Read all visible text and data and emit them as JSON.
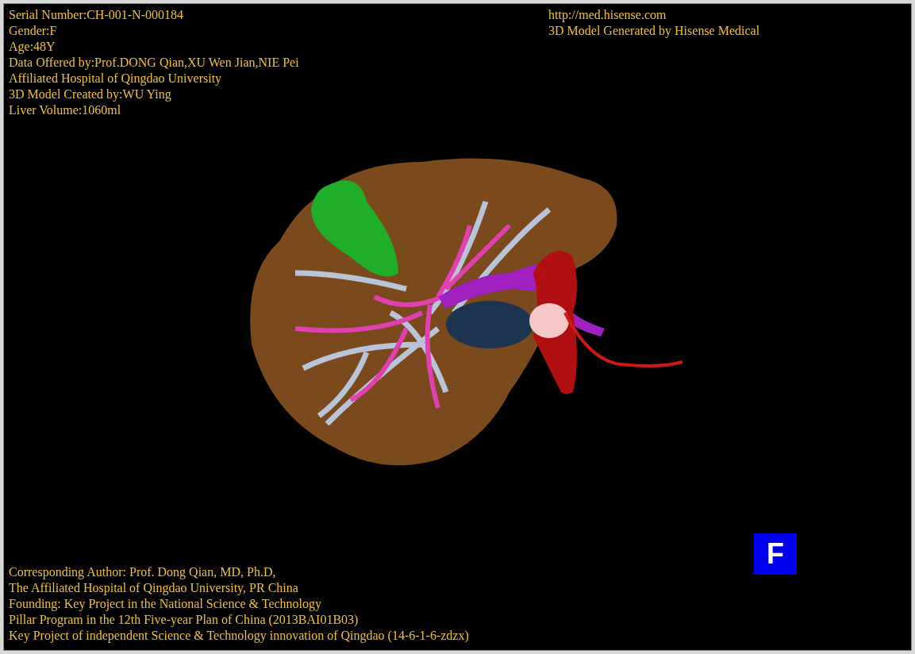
{
  "header_left": [
    "Serial Number:CH-001-N-000184",
    "Gender:F",
    "Age:48Y",
    "Data Offered by:Prof.DONG Qian,XU Wen Jian,NIE Pei",
    "Affiliated Hospital of Qingdao University",
    "3D Model Created by:WU Ying",
    "Liver Volume:1060ml"
  ],
  "header_right": [
    "http://med.hisense.com",
    "3D Model Generated by Hisense Medical"
  ],
  "orientation_marker": {
    "label": "F"
  },
  "footer": [
    "Corresponding Author: Prof. Dong Qian, MD, Ph.D,",
    "The Affiliated Hospital of Qingdao University, PR China",
    "Founding: Key Project in the National Science & Technology",
    "Pillar Program in the 12th Five-year Plan of China (2013BAI01B03)",
    "Key Project of independent Science & Technology innovation of Qingdao (14-6-1-6-zdzx)"
  ]
}
